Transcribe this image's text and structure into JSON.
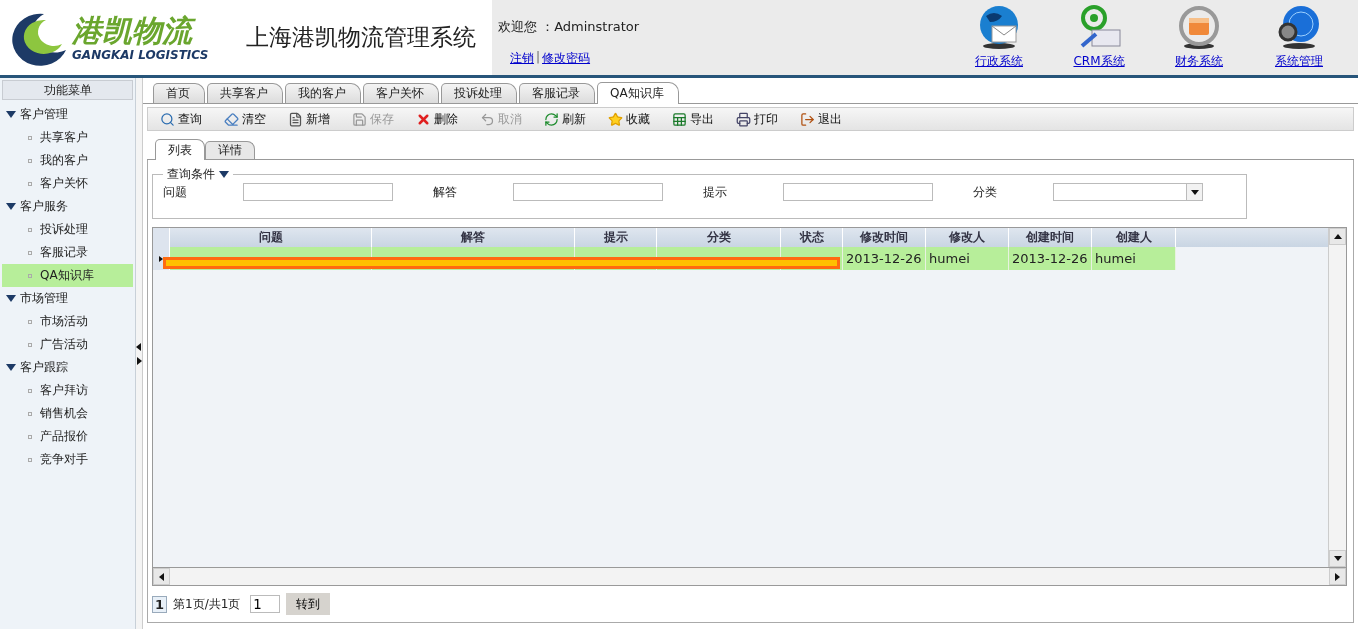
{
  "header": {
    "logo_cn": "港凯物流",
    "logo_en": "GANGKAI LOGISTICS",
    "title": "上海港凯物流管理系统",
    "welcome": "欢迎您 ：Adminstrator",
    "links": [
      "注销",
      "修改密码"
    ],
    "link_separator": "|",
    "systems": [
      {
        "label": "行政系统",
        "kind": "mail"
      },
      {
        "label": "CRM系统",
        "kind": "crm"
      },
      {
        "label": "财务系统",
        "kind": "finance"
      },
      {
        "label": "系统管理",
        "kind": "admin"
      }
    ]
  },
  "sidebar": {
    "title": "功能菜单",
    "groups": [
      {
        "label": "客户管理",
        "expanded": true,
        "children": [
          {
            "label": "共享客户",
            "selected": false
          },
          {
            "label": "我的客户",
            "selected": false
          },
          {
            "label": "客户关怀",
            "selected": false
          }
        ]
      },
      {
        "label": "客户服务",
        "expanded": true,
        "children": [
          {
            "label": "投诉处理",
            "selected": false
          },
          {
            "label": "客服记录",
            "selected": false
          },
          {
            "label": "QA知识库",
            "selected": true
          }
        ]
      },
      {
        "label": "市场管理",
        "expanded": true,
        "children": [
          {
            "label": "市场活动",
            "selected": false
          },
          {
            "label": "广告活动",
            "selected": false
          }
        ]
      },
      {
        "label": "客户跟踪",
        "expanded": true,
        "children": [
          {
            "label": "客户拜访",
            "selected": false
          },
          {
            "label": "销售机会",
            "selected": false
          },
          {
            "label": "产品报价",
            "selected": false
          },
          {
            "label": "竞争对手",
            "selected": false
          }
        ]
      }
    ]
  },
  "tabs": [
    {
      "label": "首页",
      "selected": false
    },
    {
      "label": "共享客户",
      "selected": false
    },
    {
      "label": "我的客户",
      "selected": false
    },
    {
      "label": "客户关怀",
      "selected": false
    },
    {
      "label": "投诉处理",
      "selected": false
    },
    {
      "label": "客服记录",
      "selected": false
    },
    {
      "label": "QA知识库",
      "selected": true
    }
  ],
  "toolbar": [
    {
      "label": "查询",
      "kind": "search",
      "disabled": false
    },
    {
      "label": "清空",
      "kind": "clear",
      "disabled": false
    },
    {
      "label": "新增",
      "kind": "new",
      "disabled": false
    },
    {
      "label": "保存",
      "kind": "save",
      "disabled": true
    },
    {
      "label": "删除",
      "kind": "delete",
      "disabled": false
    },
    {
      "label": "取消",
      "kind": "undo",
      "disabled": true
    },
    {
      "label": "刷新",
      "kind": "refresh",
      "disabled": false
    },
    {
      "label": "收藏",
      "kind": "star",
      "disabled": false
    },
    {
      "label": "导出",
      "kind": "export",
      "disabled": false
    },
    {
      "label": "打印",
      "kind": "print",
      "disabled": false
    },
    {
      "label": "退出",
      "kind": "exit",
      "disabled": false
    }
  ],
  "subtabs": [
    {
      "label": "列表",
      "selected": true
    },
    {
      "label": "详情",
      "selected": false
    }
  ],
  "query": {
    "legend": "查询条件",
    "fields": [
      {
        "label": "问题",
        "kind": "text"
      },
      {
        "label": "解答",
        "kind": "text"
      },
      {
        "label": "提示",
        "kind": "text"
      },
      {
        "label": "分类",
        "kind": "select"
      }
    ]
  },
  "table": {
    "columns": [
      "问题",
      "解答",
      "提示",
      "分类",
      "状态",
      "修改时间",
      "修改人",
      "创建时间",
      "创建人"
    ],
    "rows": [
      {
        "selected": true,
        "redacted": true,
        "cells": [
          "",
          "",
          "",
          "",
          "",
          "2013-12-26",
          "humei",
          "2013-12-26",
          "humei"
        ]
      }
    ]
  },
  "pager": {
    "current": "1",
    "info": "第1页/共1页",
    "page_input": "1",
    "go": "转到"
  }
}
